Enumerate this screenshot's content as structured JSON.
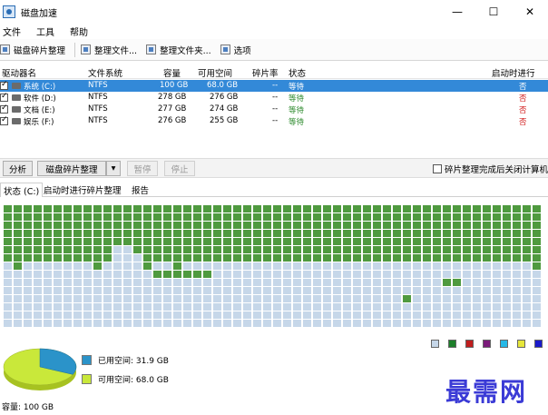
{
  "window": {
    "title": "磁盘加速",
    "min": "—",
    "max": "☐",
    "close": "✕"
  },
  "menu": [
    "文件",
    "工具",
    "帮助"
  ],
  "toolbar": [
    {
      "label": "磁盘碎片整理",
      "icon": "defrag-icon"
    },
    {
      "label": "整理文件...",
      "icon": "file-icon"
    },
    {
      "label": "整理文件夹...",
      "icon": "folder-icon"
    },
    {
      "label": "选项",
      "icon": "options-icon"
    }
  ],
  "columns": [
    "驱动器名",
    "文件系统",
    "容量",
    "可用空间",
    "碎片率",
    "状态",
    "启动时进行碎..."
  ],
  "drives": [
    {
      "name": "系统 (C:)",
      "fs": "NTFS",
      "capacity": "100 GB",
      "free": "68.0 GB",
      "frag": "--",
      "status": "等待",
      "boot": "否",
      "selected": true
    },
    {
      "name": "软件 (D:)",
      "fs": "NTFS",
      "capacity": "278 GB",
      "free": "276 GB",
      "frag": "--",
      "status": "等待",
      "boot": "否",
      "selected": false
    },
    {
      "name": "文档 (E:)",
      "fs": "NTFS",
      "capacity": "277 GB",
      "free": "274 GB",
      "frag": "--",
      "status": "等待",
      "boot": "否",
      "selected": false
    },
    {
      "name": "娱乐 (F:)",
      "fs": "NTFS",
      "capacity": "276 GB",
      "free": "255 GB",
      "frag": "--",
      "status": "等待",
      "boot": "否",
      "selected": false
    }
  ],
  "actions": {
    "analyze": "分析",
    "defrag": "磁盘碎片整理",
    "dropdown": "▾",
    "pause": "暂停",
    "stop": "停止",
    "shutdown": "碎片整理完成后关闭计算机"
  },
  "tabs": [
    "状态 (C:)",
    "启动时进行碎片整理",
    "报告"
  ],
  "legend": {
    "used": "已用空间: 31.9 GB",
    "free": "可用空间: 68.0 GB",
    "capacity": "容量: 100 GB",
    "used_color": "#2b93c9",
    "free_color": "#c9e83a",
    "used_fraction": 0.319
  },
  "map_colors": {
    "free": "#c6d7e9",
    "used": "#4f9a3f"
  },
  "legend_swatches": [
    "#c6d7e9",
    "#1d7f2a",
    "#c01e1e",
    "#7b1b7a",
    "#26b8e6",
    "#e6e63a",
    "#1a1acb"
  ],
  "watermark": "最需网"
}
